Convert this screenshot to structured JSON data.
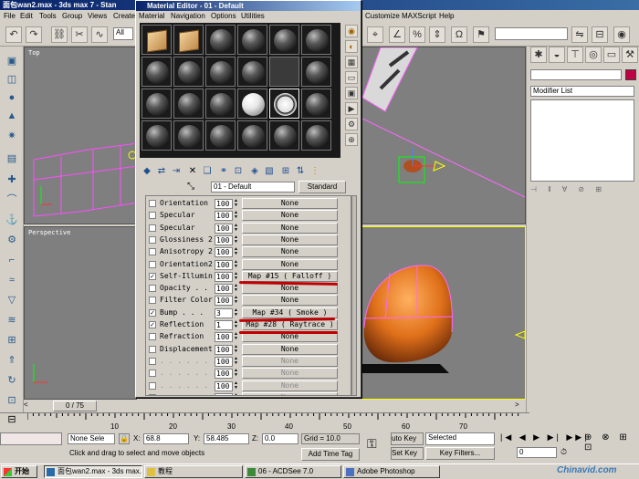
{
  "max_window": {
    "title": "面包wan2.max - 3ds max 7 - Stan",
    "menu": [
      "File",
      "Edit",
      "Tools",
      "Group",
      "Views",
      "Create",
      "Customize",
      "MAXScript",
      "Help"
    ],
    "view_dropdown": "All",
    "named_selection": ""
  },
  "viewports": {
    "top_label": "Top",
    "perspective_label": "Perspective"
  },
  "right_panel": {
    "object_name": "",
    "modifier_list_label": "Modifier List"
  },
  "material_editor": {
    "title": "Material Editor - 01 - Default",
    "menu": [
      "Material",
      "Navigation",
      "Options",
      "Utilities"
    ],
    "material_name": "01 - Default",
    "type_button": "Standard",
    "maps": [
      {
        "checked": false,
        "name": "Orientation",
        "amount": "100",
        "map": "None",
        "enabled": true
      },
      {
        "checked": false,
        "name": "Specular",
        "amount": "100",
        "map": "None",
        "enabled": true
      },
      {
        "checked": false,
        "name": "Specular",
        "amount": "100",
        "map": "None",
        "enabled": true
      },
      {
        "checked": false,
        "name": "Glossiness 2",
        "amount": "100",
        "map": "None",
        "enabled": true
      },
      {
        "checked": false,
        "name": "Anisotropy 2",
        "amount": "100",
        "map": "None",
        "enabled": true
      },
      {
        "checked": false,
        "name": "Orientation2",
        "amount": "100",
        "map": "None",
        "enabled": true
      },
      {
        "checked": true,
        "name": "Self-Illumin",
        "amount": "100",
        "map": "Map #15  ( Falloff )",
        "enabled": true
      },
      {
        "checked": false,
        "name": "Opacity . .",
        "amount": "100",
        "map": "None",
        "enabled": true
      },
      {
        "checked": false,
        "name": "Filter Color",
        "amount": "100",
        "map": "None",
        "enabled": true
      },
      {
        "checked": true,
        "name": "Bump  . . .",
        "amount": "3",
        "map": "Map #34  ( Smoke )",
        "enabled": true
      },
      {
        "checked": true,
        "name": "Reflection",
        "amount": "1",
        "map": "Map #28  ( Raytrace )",
        "enabled": true
      },
      {
        "checked": false,
        "name": "Refraction",
        "amount": "100",
        "map": "None",
        "enabled": true
      },
      {
        "checked": false,
        "name": "Displacement",
        "amount": "100",
        "map": "None",
        "enabled": true
      },
      {
        "checked": false,
        "name": ". . . . . . .",
        "amount": "100",
        "map": "None",
        "enabled": false
      },
      {
        "checked": false,
        "name": ". . . . . . .",
        "amount": "100",
        "map": "None",
        "enabled": false
      },
      {
        "checked": false,
        "name": ". . . . . . .",
        "amount": "100",
        "map": "None",
        "enabled": false
      },
      {
        "checked": false,
        "name": ". . . . . . .",
        "amount": "100",
        "map": "None",
        "enabled": false
      }
    ]
  },
  "timeline": {
    "frame_display": "0 / 75",
    "ticks": [
      "10",
      "20",
      "30",
      "40",
      "50",
      "60",
      "70"
    ]
  },
  "status_bar": {
    "selection": "None Sele",
    "x_label": "X:",
    "x_value": "68.8",
    "y_label": "Y:",
    "y_value": "58.485",
    "z_label": "Z:",
    "z_value": "0.0",
    "grid": "Grid = 10.0",
    "prompt": "Click and drag to select and move objects",
    "add_time_tag": "Add Time Tag",
    "auto_key": "uto Key",
    "selected": "Selected",
    "set_key": "Set Key",
    "key_filters": "Key Filters...",
    "frame": "0"
  },
  "taskbar": {
    "start": "开始",
    "tasks": [
      "面包wan2.max - 3ds max...",
      "教程",
      "06 - ACDSee 7.0",
      "Adobe Photoshop"
    ],
    "watermark": "Chinavid.com"
  }
}
